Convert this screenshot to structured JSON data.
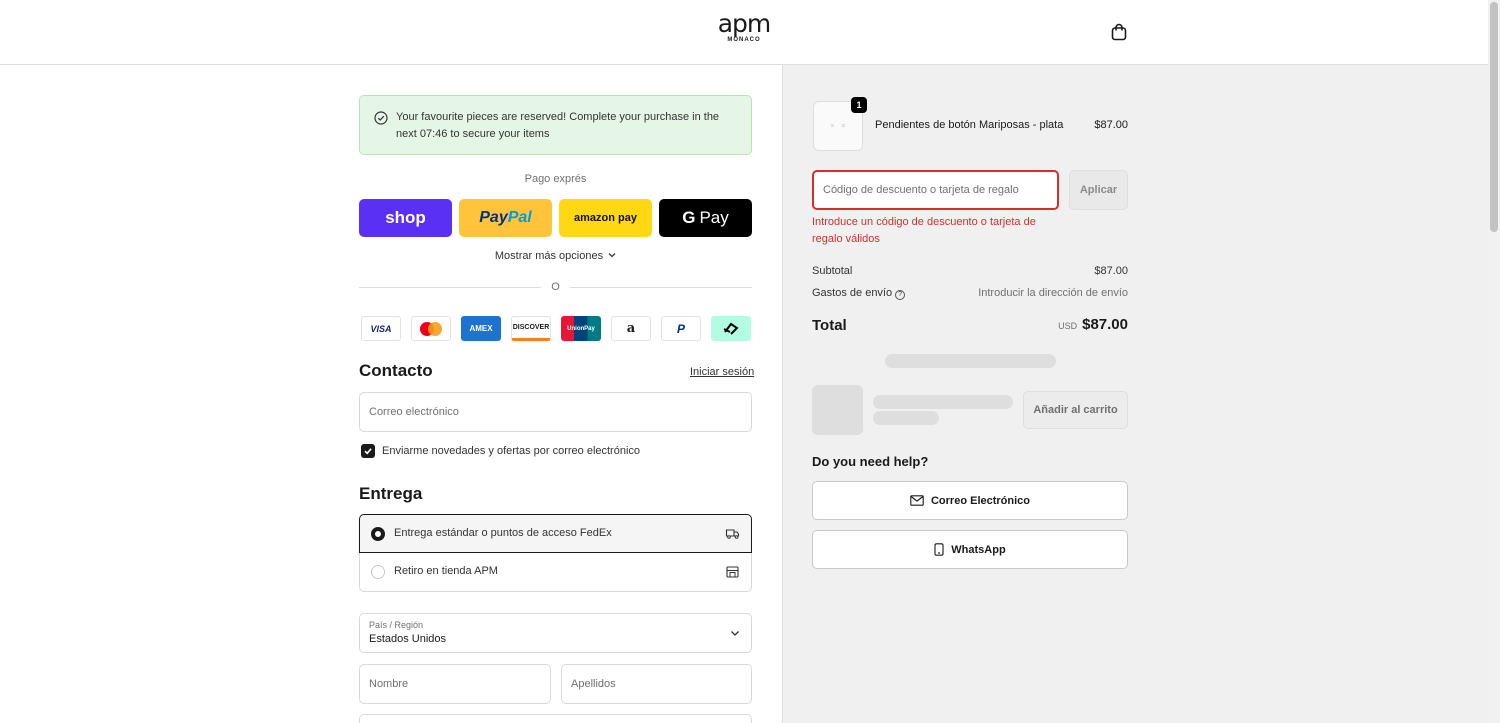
{
  "header": {
    "logo_main": "apm",
    "logo_sub": "MONACO",
    "cart_icon": "shopping-bag-icon"
  },
  "notice": {
    "icon": "check-circle-icon",
    "text": "Your favourite pieces are reserved! Complete your purchase in the next 07:46 to secure your items",
    "timer": "07:46"
  },
  "express": {
    "title": "Pago exprés",
    "buttons": {
      "shop": "shop",
      "paypal_a": "Pay",
      "paypal_b": "Pal",
      "amazon": "amazon pay",
      "gpay_g": "G",
      "gpay": "Pay"
    },
    "more_options": "Mostrar más opciones",
    "or": "O"
  },
  "payment_methods": [
    "VISA",
    "Mastercard",
    "AMEX",
    "DISCOVER",
    "UnionPay",
    "a",
    "P",
    "Afterpay"
  ],
  "contact": {
    "title": "Contacto",
    "login": "Iniciar sesión",
    "email_placeholder": "Correo electrónico",
    "newsletter_label": "Enviarme novedades y ofertas por correo electrónico",
    "newsletter_checked": true
  },
  "delivery": {
    "title": "Entrega",
    "options": [
      {
        "label": "Entrega estándar o puntos de acceso FedEx",
        "selected": true,
        "icon": "delivery-truck-icon"
      },
      {
        "label": "Retiro en tienda APM",
        "selected": false,
        "icon": "store-icon"
      }
    ],
    "country_label": "País / Región",
    "country_value": "Estados Unidos",
    "first_name_placeholder": "Nombre",
    "last_name_placeholder": "Apellidos"
  },
  "summary": {
    "item": {
      "name": "Pendientes de botón Mariposas - plata",
      "price": "$87.00",
      "qty": "1"
    },
    "discount_placeholder": "Código de descuento o tarjeta de regalo",
    "apply_label": "Aplicar",
    "error": "Introduce un código de descuento o tarjeta de regalo válidos",
    "subtotal_label": "Subtotal",
    "subtotal_value": "$87.00",
    "shipping_label": "Gastos de envío",
    "shipping_value": "Introducir la dirección de envío",
    "total_label": "Total",
    "currency": "USD",
    "total_value": "$87.00",
    "add_to_cart": "Añadir al carrito"
  },
  "help": {
    "title": "Do you need help?",
    "email": "Correo Electrónico",
    "whatsapp": "WhatsApp"
  },
  "colors": {
    "error": "#d32f2f",
    "shop": "#5a31f4",
    "paypal": "#ffc439",
    "amazon": "#ffd814",
    "notice_bg": "#e6f6e6"
  }
}
